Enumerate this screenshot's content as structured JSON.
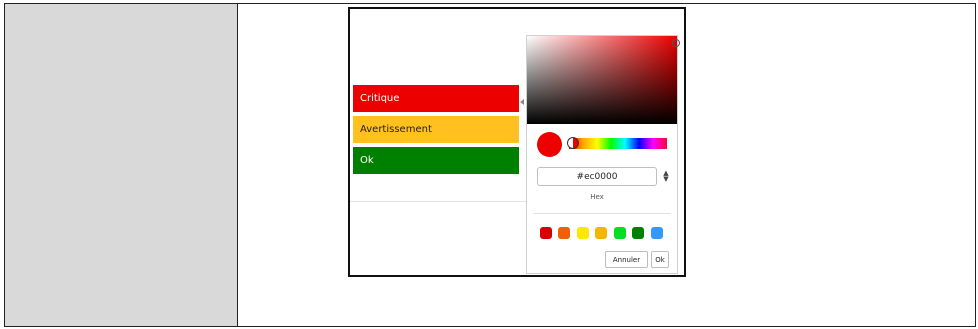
{
  "status_rows": [
    {
      "label": "Critique",
      "color": "#ec0000"
    },
    {
      "label": "Avertissement",
      "color": "#ffc020"
    },
    {
      "label": "Ok",
      "color": "#008000"
    }
  ],
  "picker": {
    "current_color": "#ec0000",
    "hex_value": "#ec0000",
    "hex_label": "Hex",
    "presets": [
      "#d80000",
      "#f06000",
      "#ffe800",
      "#f5b500",
      "#00e020",
      "#008000",
      "#3399ff"
    ],
    "cancel_label": "Annuler",
    "ok_label": "Ok"
  }
}
